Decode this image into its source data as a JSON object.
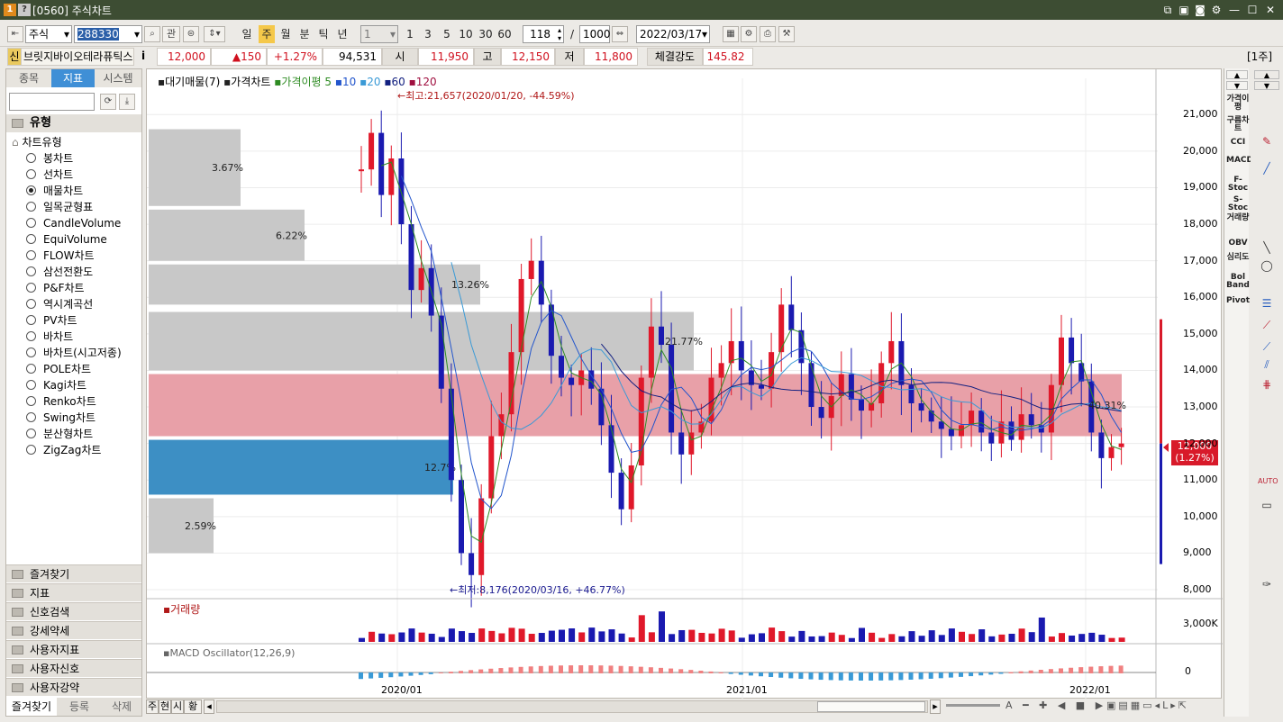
{
  "window": {
    "title": "[0560] 주식차트",
    "ctrl_icons": [
      "1",
      "?"
    ]
  },
  "toolbar": {
    "market": "주식",
    "code": "288330",
    "btn_gwan": "관",
    "periods": [
      "일",
      "주",
      "월",
      "분",
      "틱",
      "년"
    ],
    "active_period": "주",
    "interval_select": "1",
    "intervals": [
      "1",
      "3",
      "5",
      "10",
      "30",
      "60"
    ],
    "count": "118",
    "slash": "/",
    "total": "1000",
    "date": "2022/03/17"
  },
  "infobar": {
    "prefix": "신",
    "name": "브릿지바이오테라퓨틱스",
    "info_btn": "i",
    "price": "12,000",
    "change": "▲150",
    "change_pct": "+1.27%",
    "volume": "94,531",
    "open_label": "시",
    "open": "11,950",
    "high_label": "고",
    "high": "12,150",
    "low_label": "저",
    "low": "11,800",
    "strength_label": "체결강도",
    "strength": "145.82",
    "unit": "[1주]"
  },
  "leftpanel": {
    "tabs": [
      "종목",
      "지표",
      "시스템"
    ],
    "active_tab": "지표",
    "header": "유형",
    "tree_root": "차트유형",
    "chart_types": [
      "봉차트",
      "선차트",
      "매물차트",
      "일목균형표",
      "CandleVolume",
      "EquiVolume",
      "FLOW차트",
      "삼선전환도",
      "P&F차트",
      "역시계곡선",
      "PV차트",
      "바차트",
      "바차트(시고저종)",
      "POLE차트",
      "Kagi차트",
      "Renko차트",
      "Swing차트",
      "분산형차트",
      "ZigZag차트"
    ],
    "selected": "매물차트",
    "accordion": [
      "즐겨찾기",
      "지표",
      "신호검색",
      "강세약세",
      "사용자지표",
      "사용자신호",
      "사용자강약"
    ],
    "bottom_tabs": [
      "즐겨찾기",
      "등록",
      "삭제"
    ]
  },
  "chart": {
    "legend": {
      "volume_profile": "대기매물(7)",
      "price_chart": "가격차트",
      "ma_label": "가격이평",
      "ma_periods": [
        "5",
        "10",
        "20",
        "60",
        "120"
      ]
    },
    "high_annotation": "←최고:21,657(2020/01/20, -44.59%)",
    "low_annotation": "←최저:8,176(2020/03/16, +46.77%)",
    "current_price": "12,000",
    "current_pct": "(1.27%)",
    "ma_pct_label": "40.31%",
    "y_ticks": [
      "21,000",
      "20,000",
      "19,000",
      "18,000",
      "17,000",
      "16,000",
      "15,000",
      "14,000",
      "13,000",
      "12,000",
      "11,000",
      "10,000",
      "9,000",
      "8,000"
    ],
    "x_ticks": [
      "2020/01",
      "2021/01",
      "2022/01"
    ],
    "volume_title": "거래량",
    "volume_tick": "3,000K",
    "macd_title": "MACD Oscillator(12,26,9)",
    "macd_tick": "0",
    "colors": {
      "up": "#e0182a",
      "down": "#1a1ab0",
      "profile": "#c8c8c8",
      "profile_current": "#e8a0a8",
      "profile_low": "#3d8fc4"
    }
  },
  "chart_data": {
    "type": "candlestick",
    "volume_profile": [
      {
        "price_range": [
          18500,
          20600
        ],
        "pct": "3.67%"
      },
      {
        "price_range": [
          17000,
          18400
        ],
        "pct": "6.22%"
      },
      {
        "price_range": [
          15800,
          16900
        ],
        "pct": "13.26%"
      },
      {
        "price_range": [
          14000,
          15600
        ],
        "pct": "21.77%"
      },
      {
        "price_range": [
          12200,
          13900
        ],
        "pct": "40.31%"
      },
      {
        "price_range": [
          10600,
          12100
        ],
        "pct": "12.7%"
      },
      {
        "price_range": [
          9000,
          10500
        ],
        "pct": "2.59%"
      }
    ],
    "ylim": [
      8000,
      21500
    ],
    "high": 21657,
    "low": 8176
  },
  "rightnav": [
    "가격이평",
    "구름차트",
    "CCI",
    "MACD",
    "F-Stoc",
    "S-Stoc",
    "거래량",
    "OBV",
    "심리도",
    "Bol Band",
    "Pivot"
  ],
  "bottombar": {
    "buttons": [
      "주",
      "현",
      "시",
      "황"
    ]
  }
}
